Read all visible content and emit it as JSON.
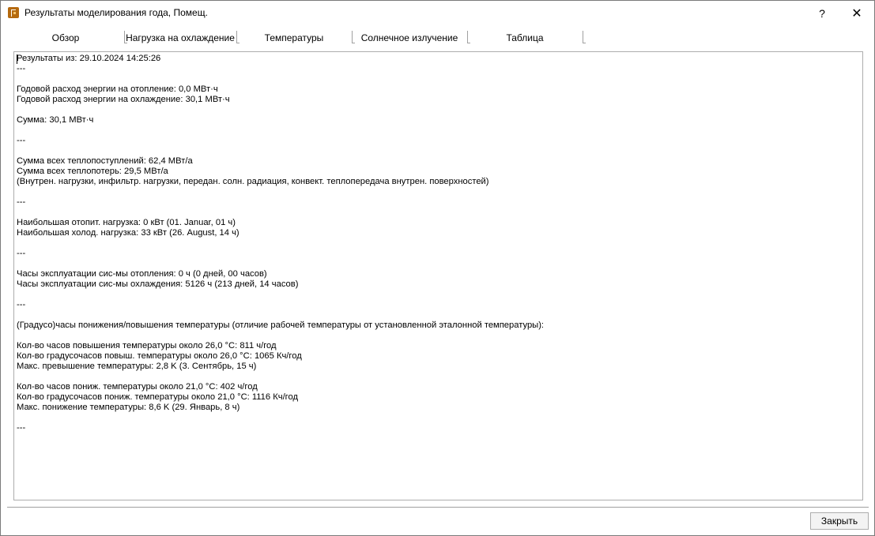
{
  "window": {
    "title": "Результаты моделирования года, Помещ.",
    "help_label": "?",
    "close_label": "✕"
  },
  "tabs": [
    {
      "label": "Обзор",
      "active": true
    },
    {
      "label": "Нагрузка на охлаждение",
      "active": false
    },
    {
      "label": "Температуры",
      "active": false
    },
    {
      "label": "Солнечное излучение",
      "active": false
    },
    {
      "label": "Таблица",
      "active": false
    }
  ],
  "report": {
    "lines": [
      "Результаты из: 29.10.2024 14:25:26",
      "---",
      "",
      "Годовой расход энергии на отопление: 0,0 МВт·ч",
      "Годовой расход энергии на охлаждение: 30,1 МВт·ч",
      "",
      "Сумма: 30,1 МВт·ч",
      "",
      "---",
      "",
      "Сумма всех теплопоступлений: 62,4 МВт/а",
      "Сумма всех теплопотерь: 29,5 МВт/а",
      "(Внутрен. нагрузки, инфильтр. нагрузки, передан. солн. радиация, конвект. теплопередача внутрен. поверхностей)",
      "",
      "---",
      "",
      "Наибольшая отопит. нагрузка: 0 кВт (01. Januar, 01 ч)",
      "Наибольшая холод. нагрузка: 33 кВт (26. August, 14 ч)",
      "",
      "---",
      "",
      "Часы эксплуатации сис-мы отопления: 0 ч (0 дней, 00 часов)",
      "Часы эксплуатации сис-мы охлаждения: 5126 ч (213 дней, 14 часов)",
      "",
      "---",
      "",
      "(Градусо)часы понижения/повышения температуры (отличие рабочей температуры от установленной эталонной температуры):",
      "",
      "Кол-во часов повышения температуры около 26,0 °C: 811 ч/год",
      "Кол-во градусочасов повыш. температуры около 26,0 °C: 1065 Кч/год",
      "Макс. превышение температуры: 2,8 K (3. Сентябрь, 15 ч)",
      "",
      "Кол-во часов пониж. температуры около 21,0 °C: 402 ч/год",
      "Кол-во градусочасов пониж. температуры около 21,0 °C: 1116 Кч/год",
      "Макс. понижение температуры: 8,6 K (29. Январь, 8 ч)",
      "",
      "---"
    ]
  },
  "footer": {
    "close_button_label": "Закрыть"
  }
}
